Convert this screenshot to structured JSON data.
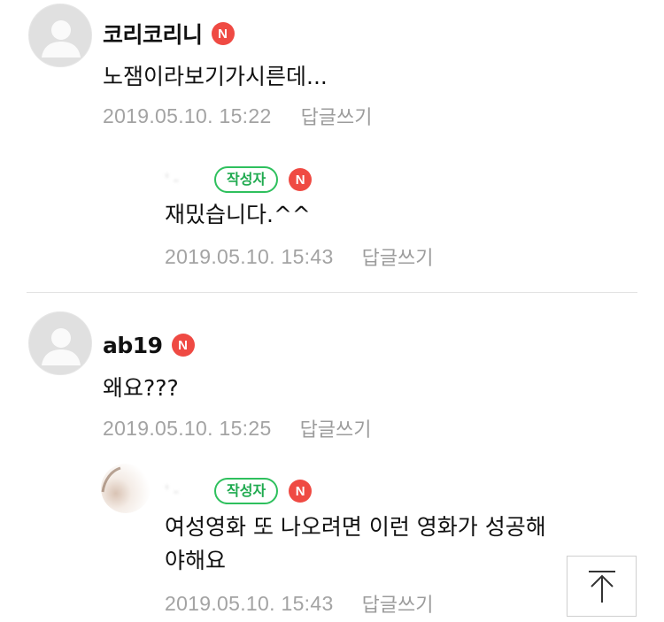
{
  "comments": [
    {
      "nickname": "코리코리니",
      "new_badge": "N",
      "text": "노잼이라보기가시른데...",
      "date": "2019.05.10. 15:22",
      "reply_label": "답글쓰기",
      "reply": {
        "nickname": "' -",
        "author_badge": "작성자",
        "new_badge": "N",
        "text": "재밌습니다.^^",
        "date": "2019.05.10. 15:43",
        "reply_label": "답글쓰기"
      }
    },
    {
      "nickname": "ab19",
      "new_badge": "N",
      "text": "왜요???",
      "date": "2019.05.10. 15:25",
      "reply_label": "답글쓰기",
      "reply": {
        "nickname": "' -",
        "author_badge": "작성자",
        "new_badge": "N",
        "text_line1": "여성영화 또 나오려면 이런 영화가 성공해",
        "text_line2": "야해요",
        "date": "2019.05.10. 15:43",
        "reply_label": "답글쓰기"
      }
    }
  ],
  "colors": {
    "new_badge": "#ef4a43",
    "author_badge": "#1faa4f",
    "meta_text": "#a3a3a3"
  },
  "icons": {
    "avatar": "default-profile-icon",
    "scroll_top": "arrow-up-to-top-icon"
  }
}
